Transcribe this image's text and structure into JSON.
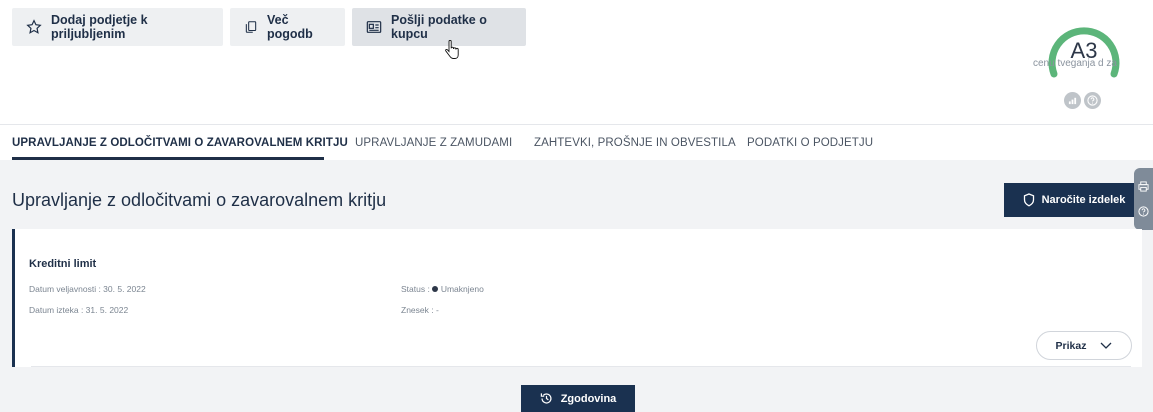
{
  "actions": {
    "favorite_label": "Dodaj podjetje k priljubljenim",
    "contracts_label": "Več pogodb",
    "send_label": "Pošlji podatke o kupcu"
  },
  "risk": {
    "grade": "A3",
    "label_visible": "cenu tveganja d za",
    "gauge_color": "#5cb57a"
  },
  "tabs": [
    {
      "label": "UPRAVLJANJE Z ODLOČITVAMI O ZAVAROVALNEM KRITJU",
      "active": true
    },
    {
      "label": "UPRAVLJANJE Z ZAMUDAMI",
      "active": false
    },
    {
      "label": "ZAHTEVKI, PROŠNJE IN OBVESTILA",
      "active": false
    },
    {
      "label": "PODATKI O PODJETJU",
      "active": false
    }
  ],
  "section": {
    "title": "Upravljanje z odločitvami o zavarovalnem kritju",
    "order_button": "Naročite izdelek"
  },
  "card": {
    "title": "Kreditni limit",
    "validity_date": "Datum veljavnosti : 30. 5. 2022",
    "expiry_date": "Datum izteka : 31. 5. 2022",
    "status_label": "Status :",
    "status_value": "Umaknjeno",
    "amount": "Znesek : -",
    "show_button": "Prikaz"
  },
  "history_button": "Zgodovina",
  "colors": {
    "navy": "#1a3150",
    "panel_bg": "#f2f3f5",
    "button_bg": "#eef0f2"
  }
}
